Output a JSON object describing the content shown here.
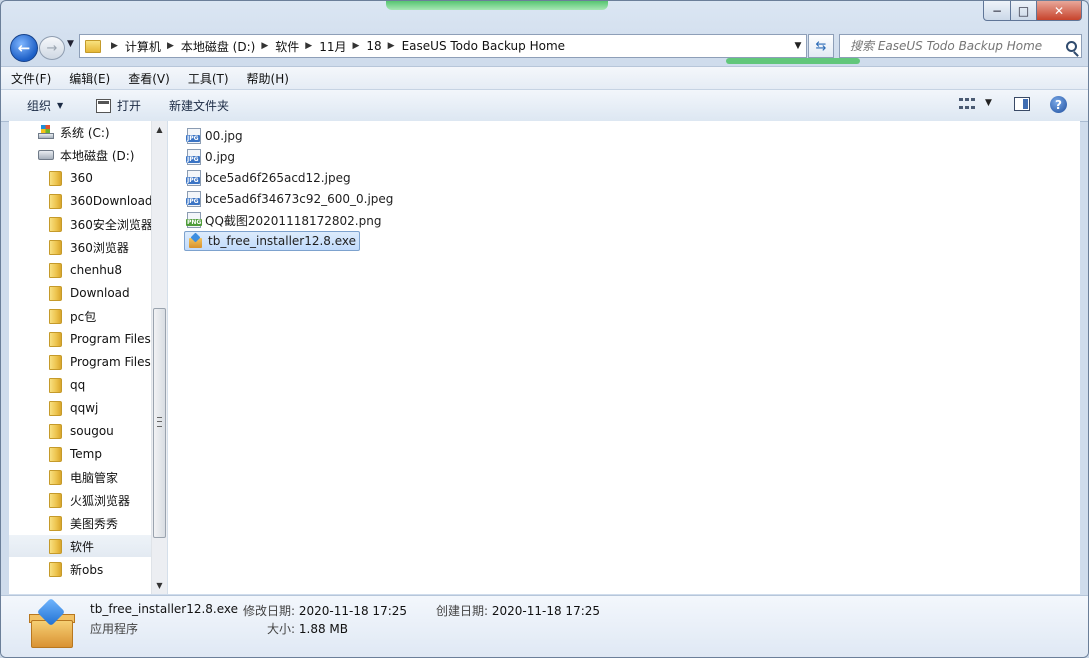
{
  "window": {
    "caption_min": "−",
    "caption_max": "□",
    "caption_close": "✕"
  },
  "nav": {
    "back_glyph": "←",
    "forward_glyph": "→",
    "breadcrumbs": [
      "计算机",
      "本地磁盘 (D:)",
      "软件",
      "11月",
      "18",
      "EaseUS Todo Backup Home"
    ],
    "search_placeholder": "搜索 EaseUS Todo Backup Home"
  },
  "menu": [
    "文件(F)",
    "编辑(E)",
    "查看(V)",
    "工具(T)",
    "帮助(H)"
  ],
  "toolbar": {
    "organize": "组织",
    "open": "打开",
    "new_folder": "新建文件夹",
    "help": "?"
  },
  "sidebar": {
    "items": [
      {
        "label": "系统 (C:)",
        "icon": "windows-drive-icon"
      },
      {
        "label": "本地磁盘 (D:)",
        "icon": "drive-icon"
      },
      {
        "label": "360",
        "icon": "folder-icon"
      },
      {
        "label": "360Download",
        "icon": "folder-icon"
      },
      {
        "label": "360安全浏览器",
        "icon": "folder-icon"
      },
      {
        "label": "360浏览器",
        "icon": "folder-icon"
      },
      {
        "label": "chenhu8",
        "icon": "folder-icon"
      },
      {
        "label": "Download",
        "icon": "folder-icon"
      },
      {
        "label": "pc包",
        "icon": "folder-icon"
      },
      {
        "label": "Program Files",
        "icon": "folder-icon"
      },
      {
        "label": "Program Files",
        "icon": "folder-icon"
      },
      {
        "label": "qq",
        "icon": "folder-icon"
      },
      {
        "label": "qqwj",
        "icon": "folder-icon"
      },
      {
        "label": "sougou",
        "icon": "folder-icon"
      },
      {
        "label": "Temp",
        "icon": "folder-icon"
      },
      {
        "label": "电脑管家",
        "icon": "folder-icon"
      },
      {
        "label": "火狐浏览器",
        "icon": "folder-icon"
      },
      {
        "label": "美图秀秀",
        "icon": "folder-icon"
      },
      {
        "label": "软件",
        "icon": "folder-icon",
        "selected": true
      },
      {
        "label": "新obs",
        "icon": "folder-icon"
      }
    ]
  },
  "files": [
    {
      "name": "00.jpg",
      "type": "JPG"
    },
    {
      "name": "0.jpg",
      "type": "JPG"
    },
    {
      "name": "bce5ad6f265acd12.jpeg",
      "type": "JPG"
    },
    {
      "name": "bce5ad6f34673c92_600_0.jpeg",
      "type": "JPG"
    },
    {
      "name": "QQ截图20201118172802.png",
      "type": "PNG"
    },
    {
      "name": "tb_free_installer12.8.exe",
      "type": "EXE",
      "selected": true
    }
  ],
  "details": {
    "name": "tb_free_installer12.8.exe",
    "type": "应用程序",
    "modified_label": "修改日期:",
    "modified_value": "2020-11-18 17:25",
    "created_label": "创建日期:",
    "created_value": "2020-11-18 17:25",
    "size_label": "大小:",
    "size_value": "1.88 MB"
  },
  "colors": {
    "selection": "#c1dbfc",
    "selection_border": "#7da2ce",
    "frame": "#cfdcec"
  }
}
